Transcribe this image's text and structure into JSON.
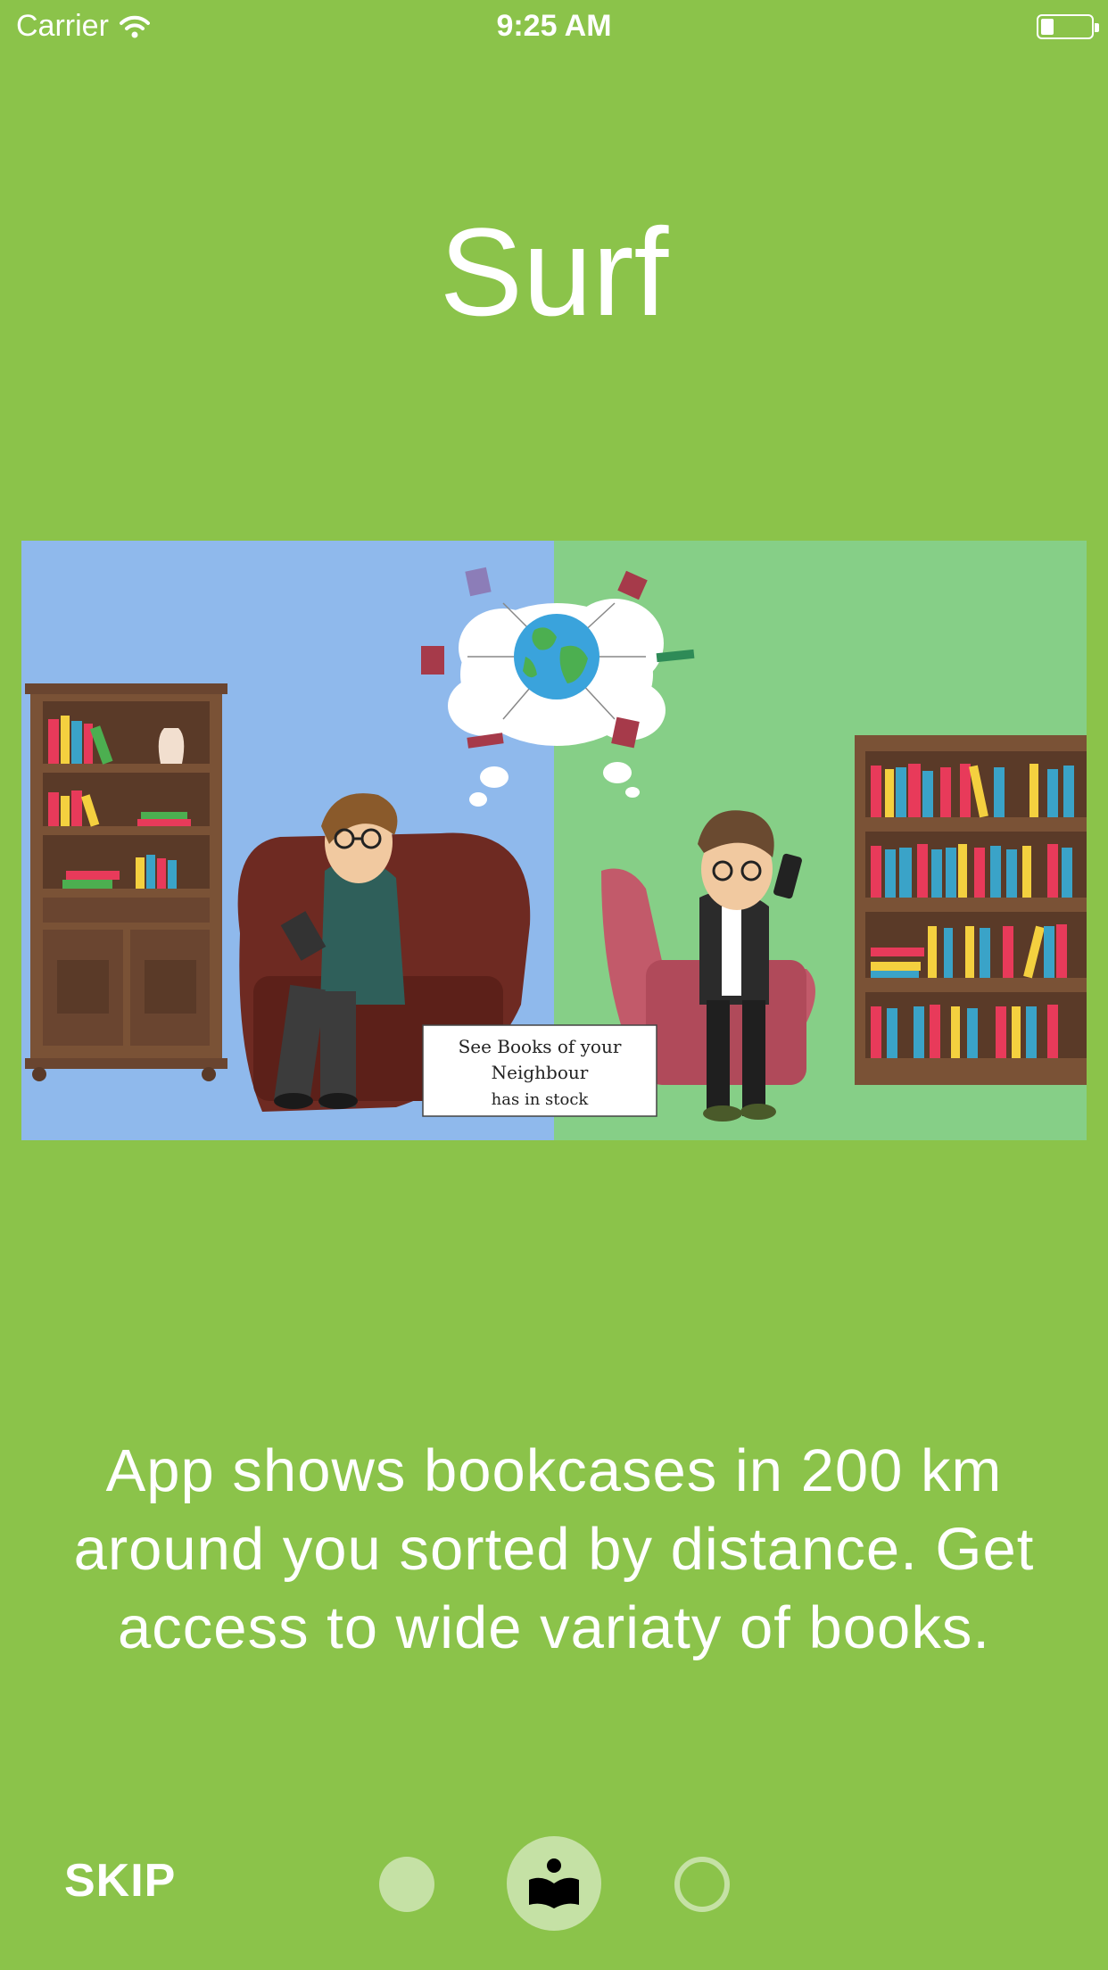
{
  "status_bar": {
    "carrier": "Carrier",
    "time": "9:25 AM",
    "icons": [
      "wifi-icon",
      "battery-icon"
    ]
  },
  "title": "Surf",
  "illustration": {
    "sign_line1": "See Books of your",
    "sign_line2": "Neighbour",
    "sign_line3": "has in stock"
  },
  "description": "App shows bookcases in 200 km around you sorted by distance. Get access to wide variaty of books.",
  "footer": {
    "skip_label": "SKIP",
    "page_count": 3,
    "current_page_icon": "book-reader-icon"
  },
  "colors": {
    "background": "#8bc34a",
    "indicator": "#c5e1a5",
    "text": "#ffffff"
  }
}
